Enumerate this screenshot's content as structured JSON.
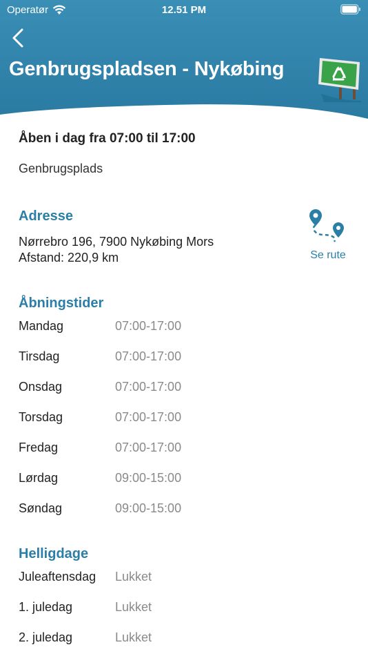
{
  "status_bar": {
    "carrier": "Operatør",
    "time": "12.51 PM"
  },
  "header": {
    "title": "Genbrugspladsen - Nykøbing",
    "icon": "recycle-sign-icon",
    "background_color": "#2b7fa6"
  },
  "info": {
    "today_open": "Åben i dag fra 07:00 til 17:00",
    "facility_type": "Genbrugsplads"
  },
  "address": {
    "heading": "Adresse",
    "street": "Nørrebro 196, 7900 Nykøbing Mors",
    "distance": "Afstand: 220,9 km",
    "route_label": "Se rute",
    "route_icon": "route-map-pin-icon"
  },
  "opening_hours": {
    "heading": "Åbningstider",
    "rows": [
      {
        "day": "Mandag",
        "hours": "07:00-17:00"
      },
      {
        "day": "Tirsdag",
        "hours": "07:00-17:00"
      },
      {
        "day": "Onsdag",
        "hours": "07:00-17:00"
      },
      {
        "day": "Torsdag",
        "hours": "07:00-17:00"
      },
      {
        "day": "Fredag",
        "hours": "07:00-17:00"
      },
      {
        "day": "Lørdag",
        "hours": "09:00-15:00"
      },
      {
        "day": "Søndag",
        "hours": "09:00-15:00"
      }
    ]
  },
  "holidays": {
    "heading": "Helligdage",
    "rows": [
      {
        "day": "Juleaftensdag",
        "hours": "Lukket"
      },
      {
        "day": "1. juledag",
        "hours": "Lukket"
      },
      {
        "day": "2. juledag",
        "hours": "Lukket"
      }
    ]
  },
  "colors": {
    "accent": "#2b7fa6",
    "muted_text": "#8a8a8a",
    "sign_green": "#3aa34a"
  }
}
